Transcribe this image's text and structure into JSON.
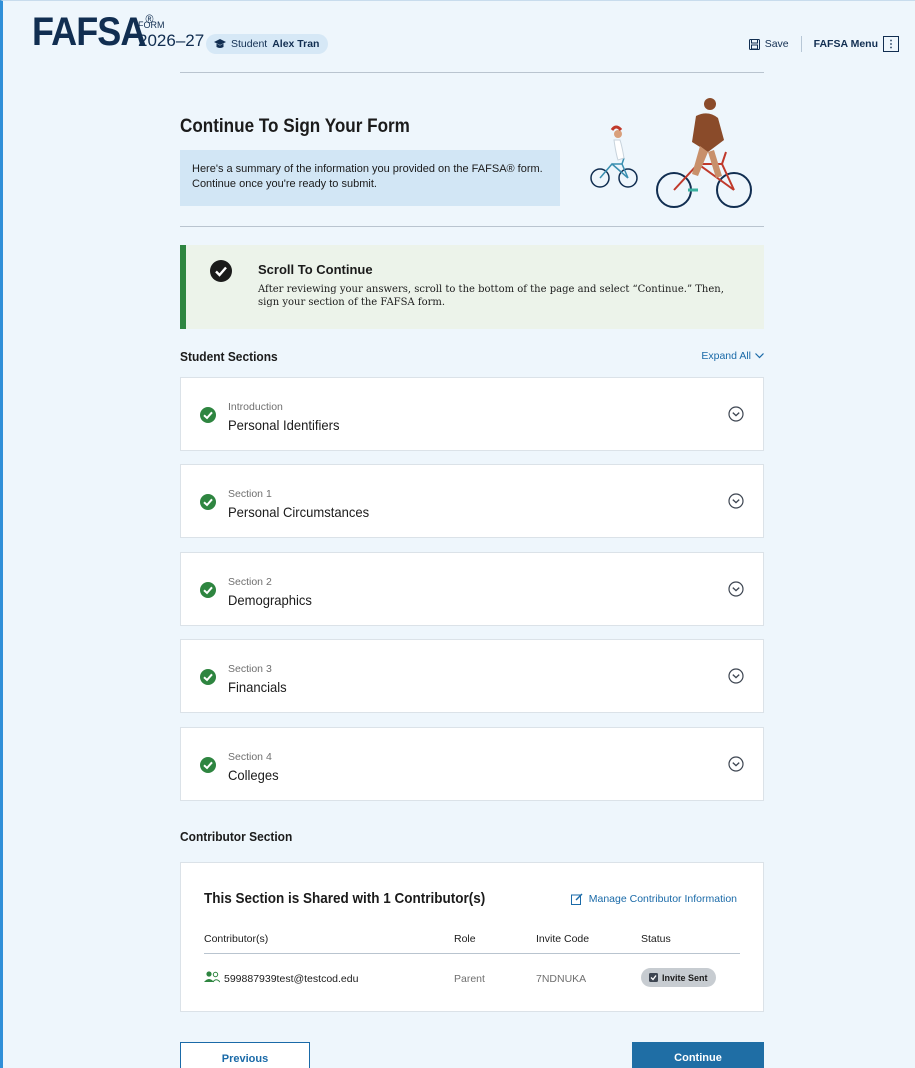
{
  "header": {
    "logo": "FAFSA",
    "logo_mark": "®",
    "form_label": "FORM",
    "form_year": "2026–27",
    "student_prefix": "Student",
    "student_name": "Alex Tran",
    "save_label": "Save",
    "menu_label": "FAFSA Menu"
  },
  "intro": {
    "title": "Continue To Sign Your Form",
    "summary": "Here's a summary of the information you provided on the FAFSA® form. Continue once you're ready to submit."
  },
  "alert": {
    "title": "Scroll To Continue",
    "body": "After reviewing your answers, scroll to the bottom of the page and select “Continue.” Then, sign your section of the FAFSA form."
  },
  "student_sections": {
    "heading": "Student Sections",
    "expand_label": "Expand All",
    "items": [
      {
        "sub": "Introduction",
        "name": "Personal Identifiers"
      },
      {
        "sub": "Section 1",
        "name": "Personal Circumstances"
      },
      {
        "sub": "Section 2",
        "name": "Demographics"
      },
      {
        "sub": "Section 3",
        "name": "Financials"
      },
      {
        "sub": "Section 4",
        "name": "Colleges"
      }
    ]
  },
  "contributor_section": {
    "heading": "Contributor Section",
    "card_title": "This Section is Shared with 1 Contributor(s)",
    "manage_label": "Manage Contributor Information",
    "columns": [
      "Contributor(s)",
      "Role",
      "Invite Code",
      "Status"
    ],
    "rows": [
      {
        "email": "599887939test@testcod.edu",
        "role": "Parent",
        "code": "7NDNUKA",
        "status": "Invite Sent"
      }
    ]
  },
  "buttons": {
    "previous": "Previous",
    "continue": "Continue"
  },
  "colors": {
    "navy": "#112e51",
    "link_blue": "#1a6aa8",
    "success_green": "#2e8540",
    "page_bg": "#eef6fc",
    "primary_button": "#1f6ea5"
  }
}
